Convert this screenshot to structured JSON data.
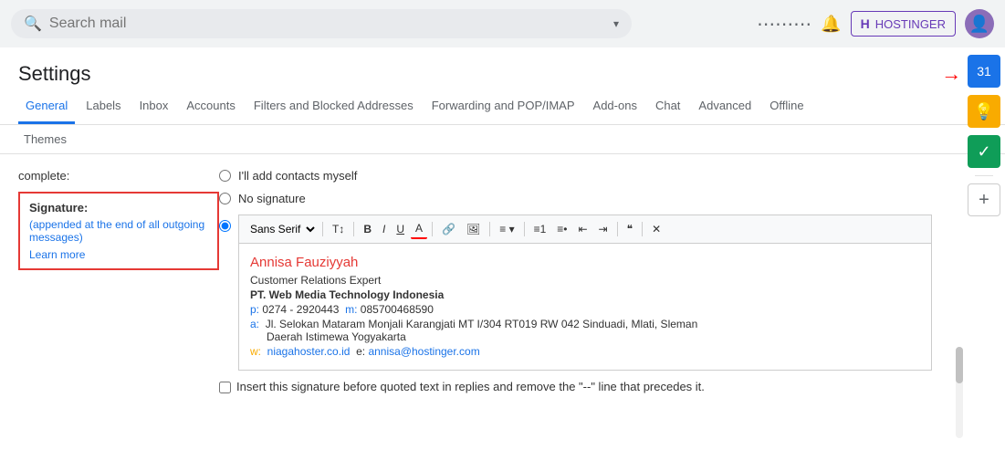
{
  "topbar": {
    "search_placeholder": "Search mail",
    "dropdown_icon": "▾",
    "hostinger_label": "HOSTINGER",
    "grid_icon": "⠿",
    "bell_icon": "🔔"
  },
  "settings": {
    "title": "Settings",
    "gear_arrow": "→",
    "gear": "⚙"
  },
  "tabs": [
    {
      "label": "General",
      "active": true
    },
    {
      "label": "Labels",
      "active": false
    },
    {
      "label": "Inbox",
      "active": false
    },
    {
      "label": "Accounts",
      "active": false
    },
    {
      "label": "Filters and Blocked Addresses",
      "active": false
    },
    {
      "label": "Forwarding and POP/IMAP",
      "active": false
    },
    {
      "label": "Add-ons",
      "active": false
    },
    {
      "label": "Chat",
      "active": false
    },
    {
      "label": "Advanced",
      "active": false
    },
    {
      "label": "Offline",
      "active": false
    }
  ],
  "sub_tabs": [
    {
      "label": "Themes"
    }
  ],
  "left_panel": {
    "complete_label": "complete:",
    "signature_title": "Signature:",
    "signature_desc": "(appended at the end of all outgoing messages)",
    "learn_more": "Learn more"
  },
  "radio_options": [
    {
      "label": "I'll add contacts myself",
      "checked": false
    },
    {
      "label": "No signature",
      "checked": false
    },
    {
      "label": "",
      "checked": true
    }
  ],
  "toolbar": {
    "font": "Sans Serif",
    "size_icon": "T↕",
    "bold": "B",
    "italic": "I",
    "underline": "U",
    "text_color": "A",
    "link": "🔗",
    "image": "🖼",
    "align": "≡",
    "numbered": "≡1",
    "bullets": "≡•",
    "indent_less": "⇤",
    "indent_more": "⇥",
    "quote": "❝",
    "remove_format": "✕"
  },
  "signature": {
    "name": "Annisa Fauziyyah",
    "role": "Customer Relations Expert",
    "company": "PT. Web Media Technology Indonesia",
    "phone_label": "p:",
    "phone": "0274 - 2920443",
    "mobile_label": "m:",
    "mobile": "085700468590",
    "address_label": "a:",
    "address1": "Jl. Selokan Mataram Monjali Karangjati MT I/304 RT019 RW 042 Sinduadi, Mlati, Sleman",
    "address2": "Daerah Istimewa Yogyakarta",
    "web_label": "w:",
    "web_url": "niagahoster.co.id",
    "email_label": "e:",
    "email": "annisa@hostinger.com"
  },
  "insert_sig": {
    "label": "Insert this signature before quoted text in replies and remove the \"--\" line that precedes it."
  },
  "right_sidebar": {
    "calendar": "31",
    "bulb": "💡",
    "check": "✓",
    "plus": "+"
  }
}
